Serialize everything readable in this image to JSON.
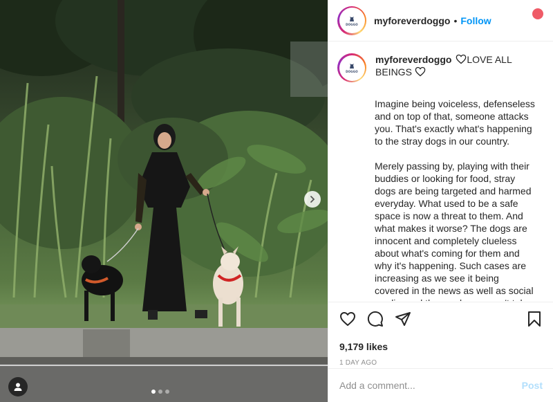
{
  "post": {
    "username": "myforeverdoggo",
    "separator": "•",
    "follow_label": "Follow",
    "avatar_logo_text": "DOGGO",
    "caption_title": "LOVE ALL BEINGS",
    "paragraphs": [
      "Imagine being voiceless, defenseless and on top of that, someone attacks you. That's exactly what's happening to the stray dogs in our country.",
      "Merely passing by, playing with their buddies or looking for food, stray dogs are being targeted and harmed everyday. What used to be a safe space is now a threat to them. And what makes it worse? The dogs are innocent and completely clueless about what's coming for them and why it's happening. Such cases are increasing as we see it being covered in the news as well as social media, and they no longer can't take it..."
    ],
    "likes": "9,179 likes",
    "timestamp": "1 DAY AGO",
    "comment_placeholder": "Add a comment...",
    "post_label": "Post"
  },
  "carousel": {
    "dot_count": 3,
    "active_dot": 0
  },
  "icons": {
    "like": "heart-icon",
    "comment": "comment-icon",
    "share": "share-icon",
    "save": "bookmark-icon",
    "next": "chevron-right-icon",
    "tags": "user-icon"
  },
  "colors": {
    "accent": "#0095f6",
    "post_disabled": "#b2dffc",
    "muted": "#8e8e8e"
  }
}
